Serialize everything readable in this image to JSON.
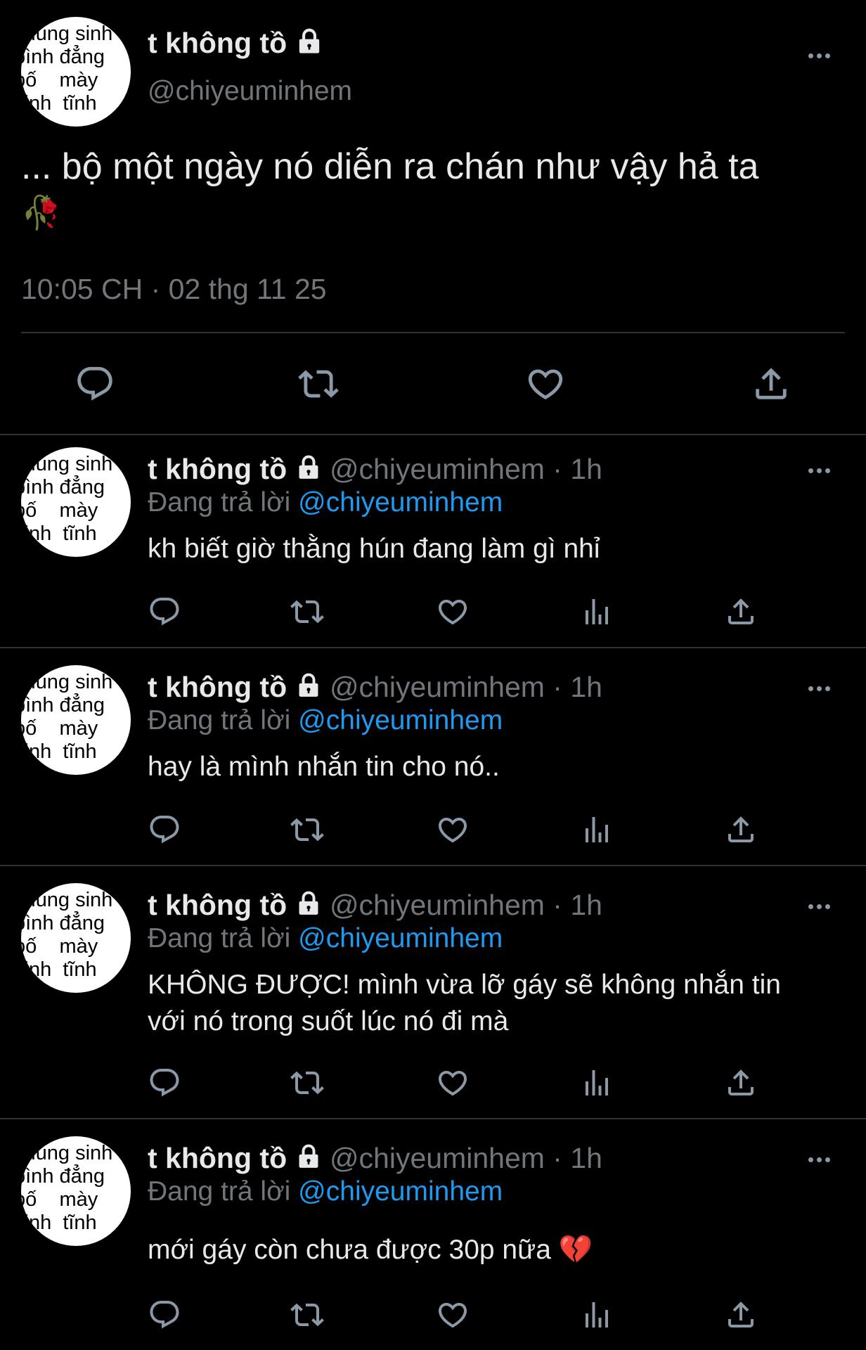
{
  "main_tweet": {
    "display_name": "t không tồ",
    "handle": "@chiyeuminhem",
    "text": "... bộ một ngày nó diễn ra chán như vậy hả ta",
    "emoji": "🥀",
    "timestamp": "10:05 CH · 02 thg 11 25"
  },
  "avatar_text": "chúng sinh\nbình đẳng\nbố    mày\nvinh  tĩnh",
  "replies": [
    {
      "display_name": "t không tồ",
      "handle_time": "@chiyeuminhem · 1h",
      "replying_prefix": "Đang trả lời",
      "replying_to": "@chiyeuminhem",
      "text": "kh biết giờ thằng hún đang làm gì nhỉ"
    },
    {
      "display_name": "t không tồ",
      "handle_time": "@chiyeuminhem · 1h",
      "replying_prefix": "Đang trả lời",
      "replying_to": "@chiyeuminhem",
      "text": "hay là mình nhắn tin cho nó.."
    },
    {
      "display_name": "t không tồ",
      "handle_time": "@chiyeuminhem · 1h",
      "replying_prefix": "Đang trả lời",
      "replying_to": "@chiyeuminhem",
      "text_line1": "KHÔNG ĐƯỢC! mình vừa lỡ gáy sẽ không nhắn tin",
      "text_line2": "với nó trong suốt lúc nó đi mà"
    },
    {
      "display_name": "t không tồ",
      "handle_time": "@chiyeuminhem · 1h",
      "replying_prefix": "Đang trả lời",
      "replying_to": "@chiyeuminhem",
      "text": "mới gáy còn chưa được 30p nữa",
      "emoji": "💔"
    }
  ],
  "colors": {
    "background": "#000000",
    "text": "#e7e9ea",
    "muted": "#71767b",
    "accent": "#1d9bf0",
    "divider": "#2f3336"
  },
  "icons": [
    "reply-icon",
    "retweet-icon",
    "like-icon",
    "views-icon",
    "share-icon",
    "lock-icon",
    "more-icon"
  ]
}
